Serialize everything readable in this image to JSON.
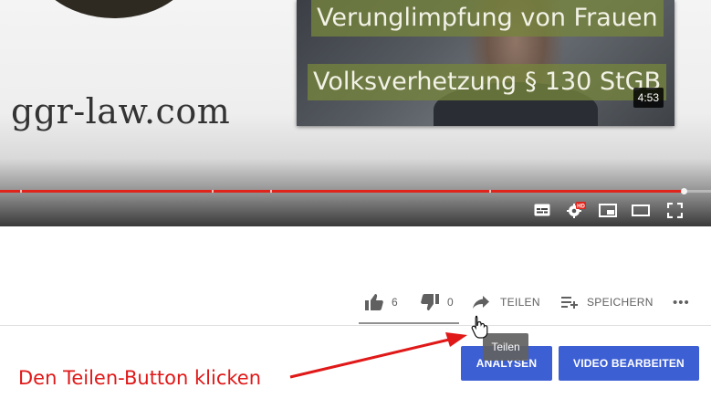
{
  "video": {
    "site_text": "ggr-law.com",
    "endscreen": {
      "line1": "Verunglimpfung von Frauen",
      "line2": "Volksverhetzung § 130 StGB",
      "duration": "4:53"
    },
    "progress_fraction": 0.96,
    "progress_color": "#e0241c",
    "controls": [
      "subtitles-icon",
      "settings-hd-icon",
      "miniplayer-icon",
      "theater-mode-icon",
      "fullscreen-icon"
    ],
    "hd_badge": "HD"
  },
  "actions": {
    "like_count": "6",
    "dislike_count": "0",
    "share_label": "TEILEN",
    "save_label": "SPEICHERN",
    "more_label": "•••"
  },
  "tooltip": "Teilen",
  "buttons": {
    "analytics_label": "ANALYSEN",
    "edit_label": "VIDEO BEARBEITEN",
    "accent": "#3d5fd4"
  },
  "annotation": {
    "text": "Den Teilen-Button klicken",
    "color": "#e01818"
  }
}
